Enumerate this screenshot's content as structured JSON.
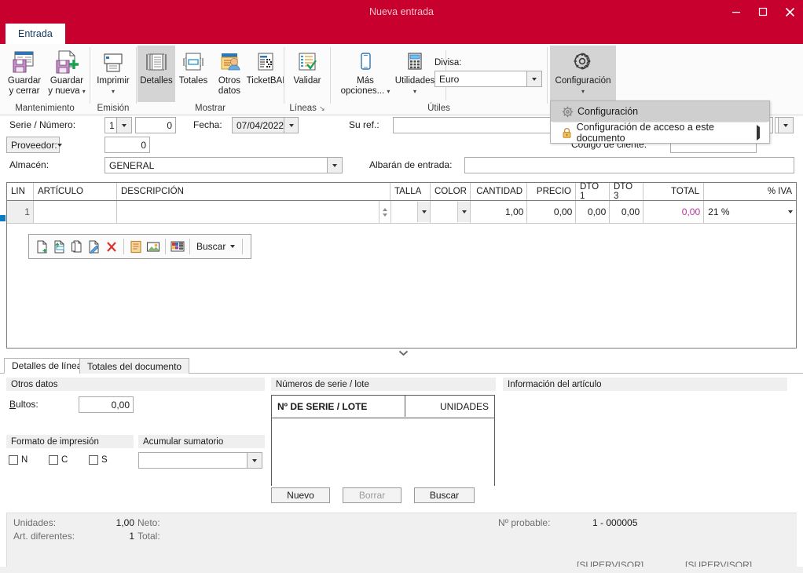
{
  "window": {
    "title": "Nueva entrada",
    "accent_color": "#c8002e",
    "minimize_label": "Minimizar",
    "maximize_label": "Maximizar",
    "close_label": "Cerrar"
  },
  "ribbon": {
    "tab_label": "Entrada",
    "groups": [
      {
        "name": "Mantenimiento",
        "label": "Mantenimiento",
        "buttons": [
          {
            "label_line1": "Guardar",
            "label_line2": "y cerrar",
            "icon": "save-close-icon",
            "has_caret": false
          },
          {
            "label_line1": "Guardar",
            "label_line2": "y nueva",
            "icon": "save-new-icon",
            "has_caret": true
          }
        ]
      },
      {
        "name": "Emision",
        "label": "Emisión",
        "buttons": [
          {
            "label_line1": "Imprimir",
            "label_line2": "",
            "icon": "printer-icon",
            "has_caret": true
          }
        ]
      },
      {
        "name": "Mostrar",
        "label": "Mostrar",
        "buttons": [
          {
            "label_line1": "Detalles",
            "label_line2": "",
            "icon": "details-icon",
            "has_caret": false,
            "active": true
          },
          {
            "label_line1": "Totales",
            "label_line2": "",
            "icon": "totals-icon",
            "has_caret": false
          },
          {
            "label_line1": "Otros",
            "label_line2": "datos",
            "icon": "other-data-icon",
            "has_caret": false
          },
          {
            "label_line1": "TicketBAI",
            "label_line2": "",
            "icon": "ticketbai-icon",
            "has_caret": false
          }
        ]
      },
      {
        "name": "Lineas",
        "label": "Líneas",
        "has_dialog_launcher": true,
        "buttons": [
          {
            "label_line1": "Validar",
            "label_line2": "",
            "icon": "validate-icon",
            "has_caret": false
          }
        ]
      },
      {
        "name": "Utiles",
        "label": "Útiles",
        "buttons": [
          {
            "label_line1": "Más",
            "label_line2": "opciones...",
            "icon": "more-options-icon",
            "has_caret": true
          },
          {
            "label_line1": "Utilidades",
            "label_line2": "",
            "icon": "utilities-icon",
            "has_caret": true
          }
        ],
        "divisa_label": "Divisa:",
        "divisa_value": "Euro"
      },
      {
        "name": "Configuracion",
        "label": "",
        "buttons": [
          {
            "label_line1": "Configuración",
            "label_line2": "",
            "icon": "gear-icon",
            "has_caret": true,
            "active": true
          }
        ]
      }
    ]
  },
  "config_menu": {
    "items": [
      {
        "label": "Configuración",
        "icon": "gear-icon",
        "selected": true,
        "submenu": false
      },
      {
        "label": "Configuración de acceso a este documento",
        "icon": "lock-icon",
        "selected": false,
        "submenu": true
      }
    ]
  },
  "form": {
    "serie_numero_label": "Serie / Número:",
    "serie_value": "1",
    "numero_value": "0",
    "fecha_label": "Fecha:",
    "fecha_value": "07/04/2022",
    "su_ref_label": "Su ref.:",
    "su_ref_value": "",
    "proveedor_label": "Proveedor:",
    "proveedor_value": "0",
    "codigo_cliente_label": "Código de cliente:",
    "codigo_cliente_value": "",
    "almacen_label": "Almacén:",
    "almacen_value": "GENERAL",
    "albaran_label": "Albarán de entrada:",
    "albaran_value": ""
  },
  "grid": {
    "columns": [
      {
        "key": "lin",
        "label": "LIN",
        "align": "left"
      },
      {
        "key": "articulo",
        "label": "ARTÍCULO",
        "align": "left"
      },
      {
        "key": "descripcion",
        "label": "DESCRIPCIÓN",
        "align": "left"
      },
      {
        "key": "talla",
        "label": "TALLA",
        "align": "left"
      },
      {
        "key": "color",
        "label": "COLOR",
        "align": "left"
      },
      {
        "key": "cantidad",
        "label": "CANTIDAD",
        "align": "right"
      },
      {
        "key": "precio",
        "label": "PRECIO",
        "align": "right"
      },
      {
        "key": "dto1",
        "label": "DTO 1",
        "align": "right"
      },
      {
        "key": "dto3",
        "label": "DTO 3",
        "align": "right"
      },
      {
        "key": "total",
        "label": "TOTAL",
        "align": "right"
      },
      {
        "key": "iva",
        "label": "% IVA",
        "align": "right"
      }
    ],
    "rows": [
      {
        "lin": "1",
        "articulo": "",
        "descripcion": "",
        "talla": "",
        "color": "",
        "cantidad": "1,00",
        "precio": "0,00",
        "dto1": "0,00",
        "dto3": "0,00",
        "total": "0,00",
        "iva": "21 %"
      }
    ],
    "total_color": "#b0369c"
  },
  "line_toolbar": {
    "icons": [
      "new-line-icon",
      "insert-line-icon",
      "copy-line-icon",
      "edit-line-icon",
      "delete-line-icon",
      "notes-icon",
      "image-icon",
      "colors-icon"
    ],
    "buscar_label": "Buscar"
  },
  "bottom_tabs": [
    {
      "label": "Detalles de línea",
      "active": true
    },
    {
      "label": "Totales del documento",
      "active": false
    }
  ],
  "otros_datos": {
    "header": "Otros datos",
    "bultos_label": "Bultos:",
    "bultos_value": "0,00",
    "formato_impresion_label": "Formato de impresión",
    "acumular_label": "Acumular sumatorio",
    "acumular_value": "",
    "checkboxes": [
      {
        "label": "N",
        "checked": false
      },
      {
        "label": "C",
        "checked": false
      },
      {
        "label": "S",
        "checked": false
      }
    ]
  },
  "serie_lote": {
    "header": "Números de serie / lote",
    "col_serie": "Nº DE SERIE / LOTE",
    "col_unidades": "UNIDADES",
    "rows": [],
    "buttons": [
      {
        "label": "Nuevo",
        "enabled": true
      },
      {
        "label": "Borrar",
        "enabled": false
      },
      {
        "label": "Buscar",
        "enabled": true
      }
    ]
  },
  "info_articulo": {
    "header": "Información del artículo"
  },
  "status": {
    "unidades_label": "Unidades:",
    "unidades_value": "1,00",
    "neto_label": "Neto:",
    "neto_value": "",
    "art_diferentes_label": "Art. diferentes:",
    "art_diferentes_value": "1",
    "total_label": "Total:",
    "total_value": "",
    "num_probable_label": "Nº probable:",
    "num_probable_value": "1 - 000005",
    "user_left": "[SUPERVISOR]",
    "user_right": "[SUPERVISOR]"
  }
}
